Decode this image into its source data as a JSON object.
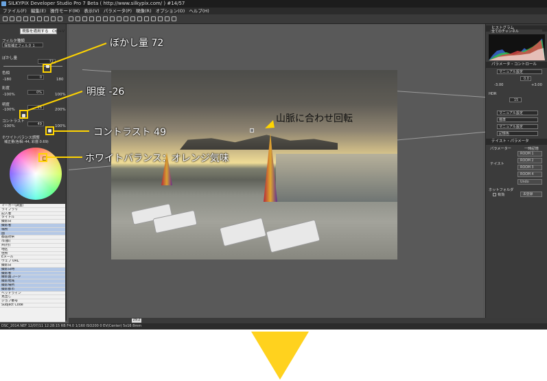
{
  "app": {
    "title": "SILKYPIX Developer Studio Pro 7 Beta ( http://www.silkypix.com/ )   #14/57",
    "menu": [
      "ファイル(F)",
      "編集(E)",
      "操作モード(M)",
      "表示(V)",
      "パラメータ(P)",
      "現像(R)",
      "オプション(O)",
      "ヘルプ(H)"
    ],
    "tooltip": "現像を適用する　Ctrl+V",
    "status": "DSC_2014.NEF 12/07/11 12:28:15 RB F4.0 1/160 ISO200 0 EV(Center) 5x16 8mm"
  },
  "left_panel": {
    "filter_label": "フィルタ種類",
    "filter_value": "保有補正フィルタ 1",
    "blur_label": "ぼかし量",
    "blur_value": "72",
    "hue_label": "色相",
    "hue_min": "-180",
    "hue_value": "0",
    "hue_max": "180",
    "saturation_label": "彩度",
    "saturation_min": "-100%",
    "saturation_value": "0%",
    "saturation_max": "100%",
    "brightness_label": "明度",
    "brightness_min": "-100%",
    "brightness_value": "-26",
    "brightness_max": "200%",
    "contrast_label": "コントラスト",
    "contrast_min": "-100%",
    "contrast_value": "49",
    "contrast_max": "100%",
    "wb_label": "ホワイトバランス調整",
    "wb_value": "補正量(色相:-44, 彩度:0.69)",
    "metadata": [
      "マーカー(調査)",
      "ライブラリ",
      "記入者",
      "タイトル",
      "撮影日",
      "撮影者",
      "場所",
      "国",
      "都道府県",
      "市(都)",
      "州(付)",
      "地区",
      "住所",
      "Eメール",
      "ウェブ URL",
      "撮影日",
      "撮影日時",
      "撮影者",
      "撮影国コード",
      "撮影地域",
      "撮影場所",
      "撮影都市",
      "ヘッドライン",
      "見出し",
      "ジョブ番号",
      "Subject Code"
    ]
  },
  "right_panel": {
    "histogram_label": "ヒストグラム",
    "channel": "全てのチャンネル",
    "param_control": "パラメータ・コントロール",
    "preset": "マニュアル設定",
    "exposure_value": "0.0",
    "exposure_min": "-3.00",
    "exposure_max": "+3.00",
    "hdr_label": "HDR",
    "hdr_value": "15",
    "wb_preset": "マニュアル設定",
    "tone_preset": "標準",
    "color_preset": "マニュアル設定",
    "sharp_preset": "記憶色",
    "taste_header": "テイスト・パラメータ",
    "param_group": "パラメーター",
    "taste_group": "テイスト",
    "history_group": "一時記憶",
    "rooms": [
      "ROOM 1",
      "ROOM 2",
      "ROOM 3",
      "ROOM 4"
    ],
    "reset_button": "Undo",
    "hot_folder": "ホットフォルダ",
    "enable_checkbox": "有効",
    "unset_button": "未登録"
  },
  "canvas": {
    "zoom": "29.2"
  },
  "annotations": {
    "blur": "ぼかし量 72",
    "brightness": "明度 -26",
    "contrast": "コントラスト 49",
    "white_balance": "ホワイトバランス：オレンジ気味",
    "rotate": "山脈に合わせ回転"
  },
  "colors": {
    "highlight": "#ffd400",
    "arrow": "#ffd21e"
  }
}
